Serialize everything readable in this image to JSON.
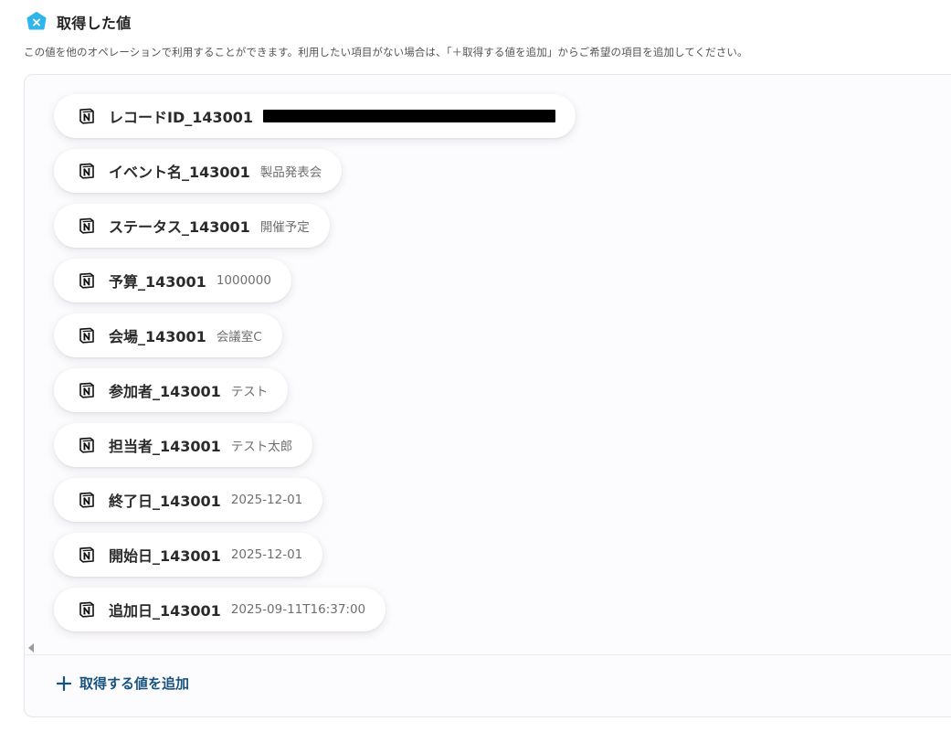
{
  "header": {
    "title": "取得した値",
    "icon": "yoom-logo-icon",
    "icon_color": "#2fb5ea"
  },
  "description": "この値を他のオペレーションで利用することができます。利用したい項目がない場合は、「＋取得する値を追加」からご希望の項目を追加してください。",
  "items": [
    {
      "label": "レコードID_143001",
      "value": "",
      "redacted": true,
      "icon": "notion-icon"
    },
    {
      "label": "イベント名_143001",
      "value": "製品発表会",
      "icon": "notion-icon"
    },
    {
      "label": "ステータス_143001",
      "value": "開催予定",
      "icon": "notion-icon"
    },
    {
      "label": "予算_143001",
      "value": "1000000",
      "icon": "notion-icon"
    },
    {
      "label": "会場_143001",
      "value": "会議室C",
      "icon": "notion-icon"
    },
    {
      "label": "参加者_143001",
      "value": "テスト",
      "icon": "notion-icon"
    },
    {
      "label": "担当者_143001",
      "value": "テスト太郎",
      "icon": "notion-icon"
    },
    {
      "label": "終了日_143001",
      "value": "2025-12-01",
      "icon": "notion-icon"
    },
    {
      "label": "開始日_143001",
      "value": "2025-12-01",
      "icon": "notion-icon"
    },
    {
      "label": "追加日_143001",
      "value": "2025-09-11T16:37:00",
      "icon": "notion-icon"
    }
  ],
  "add_button": {
    "label": "取得する値を追加",
    "icon": "plus-icon",
    "color": "#17537d"
  }
}
